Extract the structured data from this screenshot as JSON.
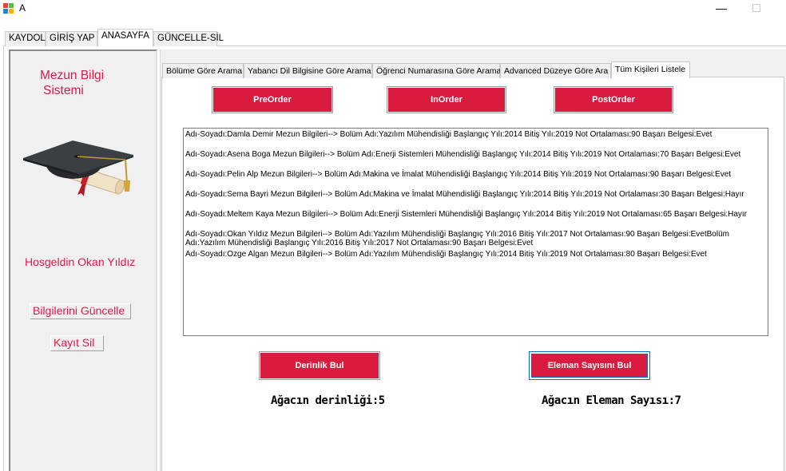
{
  "window": {
    "title": "A",
    "minimize_glyph": "—"
  },
  "main_tabs": [
    "KAYDOL",
    "GİRİŞ YAP",
    "ANASAYFA",
    "GÜNCELLE-SİL"
  ],
  "sidebar": {
    "app_name_line1": "Mezun Bilgi",
    "app_name_line2": "Sistemi",
    "image_icon": "graduation-cap-diploma-icon",
    "welcome": "Hosgeldin  Okan Yıldız",
    "update_link": "Bilgilerini Güncelle",
    "delete_link": "Kayıt Sil"
  },
  "sub_tabs": [
    "Bölüme Göre Arama",
    "Yabancı Dil Bilgisine Göre Arama",
    "Öğrenci Numarasına Göre Arama",
    "Advanced Düzeye Göre Ara",
    "Tüm Kişileri Listele"
  ],
  "traversal_buttons": {
    "preorder": "PreOrder",
    "inorder": "InOrder",
    "postorder": "PostOrder"
  },
  "list_items": [
    "Adı-Soyadı:Damla Demir Mezun Bilgileri--> Bolüm Adı:Yazılım Mühendisliği Başlangıç Yılı:2014 Bitiş Yılı:2019 Not Ortalaması:90 Başarı Belgesi:Evet",
    "Adı-Soyadı:Asena Boga Mezun Bilgileri--> Bolüm Adı:Enerji Sistemleri Mühendisliği Başlangıç Yılı:2014 Bitiş Yılı:2019 Not Ortalaması:70 Başarı Belgesi:Evet",
    "Adı-Soyadı:Pelin Alp Mezun Bilgileri--> Bolüm Adı:Makina ve İmalat Mühendisliği Başlangıç Yılı:2014 Bitiş Yılı:2019 Not Ortalaması:90 Başarı Belgesi:Evet",
    "Adı-Soyadı:Sema Bayri Mezun Bilgileri--> Bolüm Adı:Makina ve İmalat Mühendisliği Başlangıç Yılı:2014 Bitiş Yılı:2019 Not Ortalaması:30 Başarı Belgesi:Hayır",
    "Adı-Soyadı:Meltem Kaya Mezun Bilgileri--> Bolüm Adı:Enerji Sistemleri Mühendisliği Başlangıç Yılı:2014 Bitiş Yılı:2019 Not Ortalaması:65 Başarı Belgesi:Hayır",
    "Adı-Soyadı:Okan Yıldız Mezun Bilgileri--> Bolüm Adı:Yazılım Mühendisliği Başlangıç Yılı:2016 Bitiş Yılı:2017 Not Ortalaması:90 Başarı Belgesi:EvetBolüm\nAdı:Yazılım Mühendisliği Başlangıç Yılı:2016 Bitiş Yılı:2017 Not Ortalaması:90 Başarı Belgesi:Evet",
    "Adı-Soyadı:Ozge Algan Mezun Bilgileri--> Bolüm Adı:Yazılım Mühendisliği Başlangıç Yılı:2014 Bitiş Yılı:2019 Not Ortalaması:80 Başarı Belgesi:Evet"
  ],
  "tree_buttons": {
    "depth": "Derinlik Bul",
    "count": "Eleman Sayısını Bul"
  },
  "results": {
    "depth": "Ağacın derinliği:5",
    "count": "Ağacın Eleman Sayısı:7"
  },
  "colors": {
    "accent_red": "#d81b3f",
    "text_red": "#e0194a",
    "focus_blue": "#0b6ad0"
  }
}
